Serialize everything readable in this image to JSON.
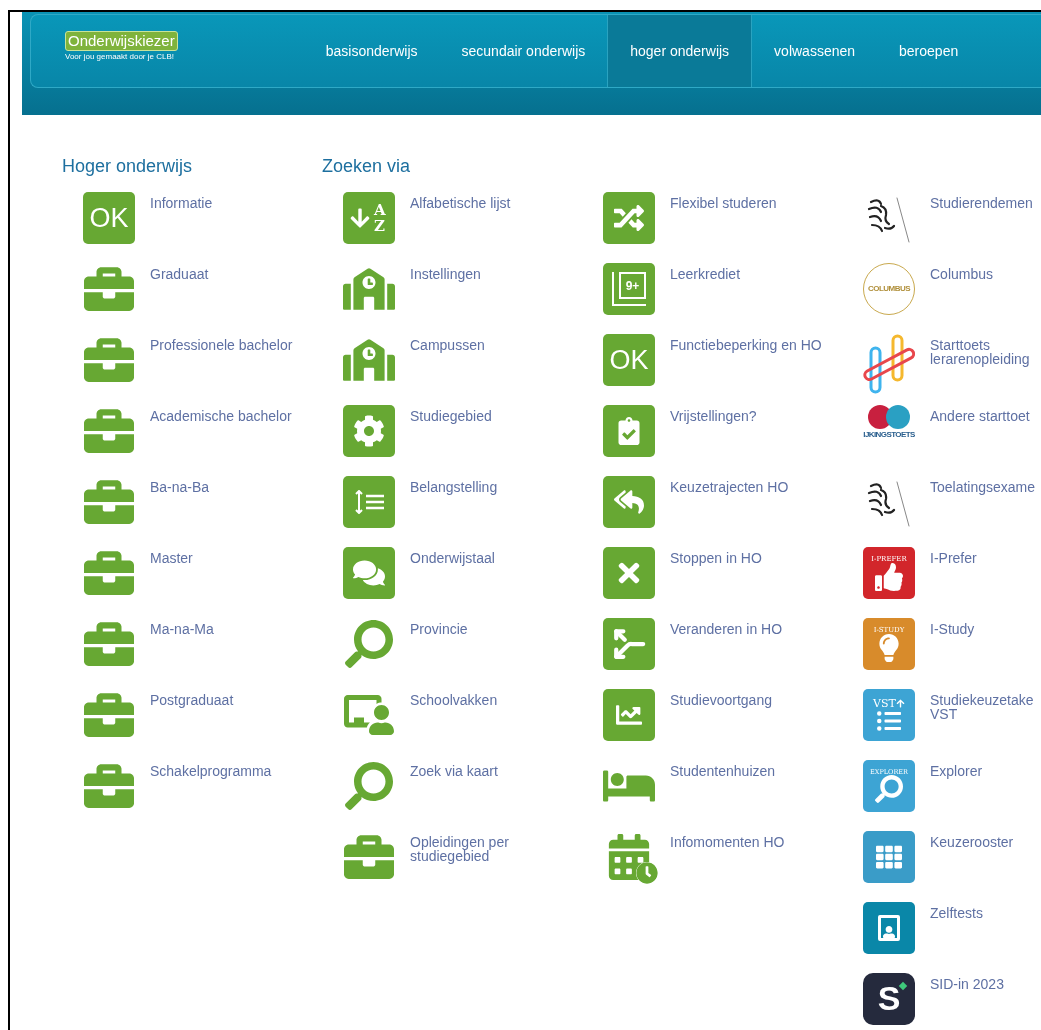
{
  "logo": {
    "name": "Onderwijskiezer",
    "tagline": "Voor jou gemaakt door je CLB!"
  },
  "nav": [
    {
      "label": "basisonderwijs",
      "selected": false
    },
    {
      "label": "secundair onderwijs",
      "selected": false
    },
    {
      "label": "hoger onderwijs",
      "selected": true
    },
    {
      "label": "volwassenen",
      "selected": false
    },
    {
      "label": "beroepen",
      "selected": false
    }
  ],
  "sections": [
    {
      "heading": "Hoger onderwijs",
      "columns": [
        [
          {
            "label": "Informatie",
            "kind": "ok",
            "icon_text": "OK"
          },
          {
            "label": "Graduaat",
            "kind": "briefcase"
          },
          {
            "label": "Professionele bachelor",
            "kind": "briefcase"
          },
          {
            "label": "Academische bachelor",
            "kind": "briefcase"
          },
          {
            "label": "Ba-na-Ba",
            "kind": "briefcase"
          },
          {
            "label": "Master",
            "kind": "briefcase"
          },
          {
            "label": "Ma-na-Ma",
            "kind": "briefcase"
          },
          {
            "label": "Postgraduaat",
            "kind": "briefcase"
          },
          {
            "label": "Schakelprogramma",
            "kind": "briefcase"
          }
        ]
      ]
    },
    {
      "heading": "Zoeken via",
      "columns": [
        [
          {
            "label": "Alfabetische lijst",
            "kind": "az",
            "icon_text": "AZ"
          },
          {
            "label": "Instellingen",
            "kind": "school"
          },
          {
            "label": "Campussen",
            "kind": "school"
          },
          {
            "label": "Studiegebied",
            "kind": "gear"
          },
          {
            "label": "Belangstelling",
            "kind": "sortlist"
          },
          {
            "label": "Onderwijstaal",
            "kind": "chat"
          },
          {
            "label": "Provincie",
            "kind": "search"
          },
          {
            "label": "Schoolvakken",
            "kind": "teacher"
          },
          {
            "label": "Zoek via kaart",
            "kind": "search"
          },
          {
            "label": "Opleidingen per studiegebied",
            "kind": "briefcase"
          }
        ],
        [
          {
            "label": "Flexibel studeren",
            "kind": "shuffle"
          },
          {
            "label": "Leerkrediet",
            "kind": "layers",
            "icon_text": "9+"
          },
          {
            "label": "Functiebeperking en HO",
            "kind": "ok",
            "icon_text": "OK"
          },
          {
            "label": "Vrijstellingen?",
            "kind": "clipboard"
          },
          {
            "label": "Keuzetrajecten HO",
            "kind": "replyall"
          },
          {
            "label": "Stoppen in HO",
            "kind": "close"
          },
          {
            "label": "Veranderen in HO",
            "kind": "fork"
          },
          {
            "label": "Studievoortgang",
            "kind": "trend"
          },
          {
            "label": "Studentenhuizen",
            "kind": "bed"
          },
          {
            "label": "Infomomenten HO",
            "kind": "calendar"
          }
        ]
      ]
    },
    {
      "columns": [
        [
          {
            "label": "Studierendemen",
            "kind": "lion"
          },
          {
            "label": "Columbus",
            "kind": "columbus",
            "icon_text": "COLUMBUS"
          },
          {
            "label": "Starttoets lerarenopleiding",
            "kind": "hashtag"
          },
          {
            "label": "Andere starttoet",
            "kind": "ijking",
            "icon_text": "IJKINGSTOETS"
          },
          {
            "label": "Toelatingsexame",
            "kind": "lion"
          },
          {
            "label": "I-Prefer",
            "kind": "iprefer",
            "icon_text": "I-PREFER"
          },
          {
            "label": "I-Study",
            "kind": "istudy",
            "icon_text": "I-STUDY"
          },
          {
            "label": "Studiekeuzetake VST",
            "kind": "vst",
            "icon_text": "VST"
          },
          {
            "label": "Explorer",
            "kind": "explorer",
            "icon_text": "EXPLORER"
          },
          {
            "label": "Keuzerooster",
            "kind": "grid"
          },
          {
            "label": "Zelftests",
            "kind": "idcard"
          },
          {
            "label": "SID-in 2023",
            "kind": "slogo",
            "icon_text": "S"
          }
        ]
      ]
    }
  ]
}
